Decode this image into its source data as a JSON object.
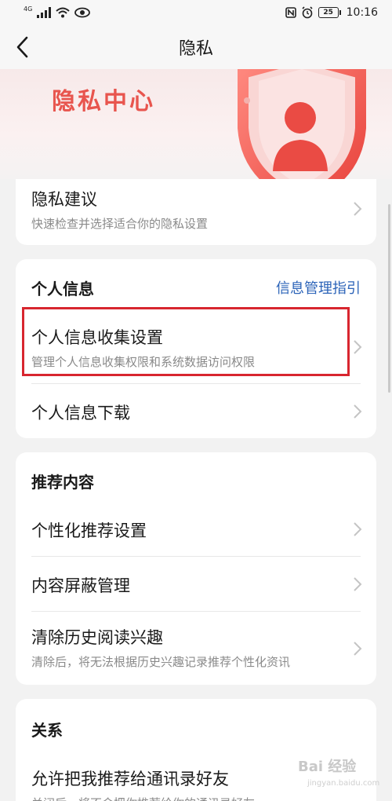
{
  "status_bar": {
    "network": "4G",
    "battery": "25",
    "time": "10:16"
  },
  "header": {
    "title": "隐私"
  },
  "banner": {
    "title": "隐私中心"
  },
  "privacy_advice": {
    "title": "隐私建议",
    "subtitle": "快速检查并选择适合你的隐私设置"
  },
  "personal_info": {
    "heading": "个人信息",
    "guide_link": "信息管理指引",
    "items": [
      {
        "title": "个人信息收集设置",
        "subtitle": "管理个人信息收集权限和系统数据访问权限"
      },
      {
        "title": "个人信息下载",
        "subtitle": ""
      }
    ]
  },
  "recommend": {
    "heading": "推荐内容",
    "items": [
      {
        "title": "个性化推荐设置",
        "subtitle": ""
      },
      {
        "title": "内容屏蔽管理",
        "subtitle": ""
      },
      {
        "title": "清除历史阅读兴趣",
        "subtitle": "清除后，将无法根据历史兴趣记录推荐个性化资讯"
      }
    ]
  },
  "relations": {
    "heading": "关系",
    "items": [
      {
        "title": "允许把我推荐给通讯录好友",
        "subtitle": "关闭后，将不会把你推荐给你的通讯录好友"
      }
    ]
  },
  "watermark": {
    "text": "Bai 经验",
    "sub": "jingyan.baidu.com"
  },
  "colors": {
    "accent_red": "#e8554e",
    "link_blue": "#2b63b8",
    "highlight": "#d8262f"
  }
}
